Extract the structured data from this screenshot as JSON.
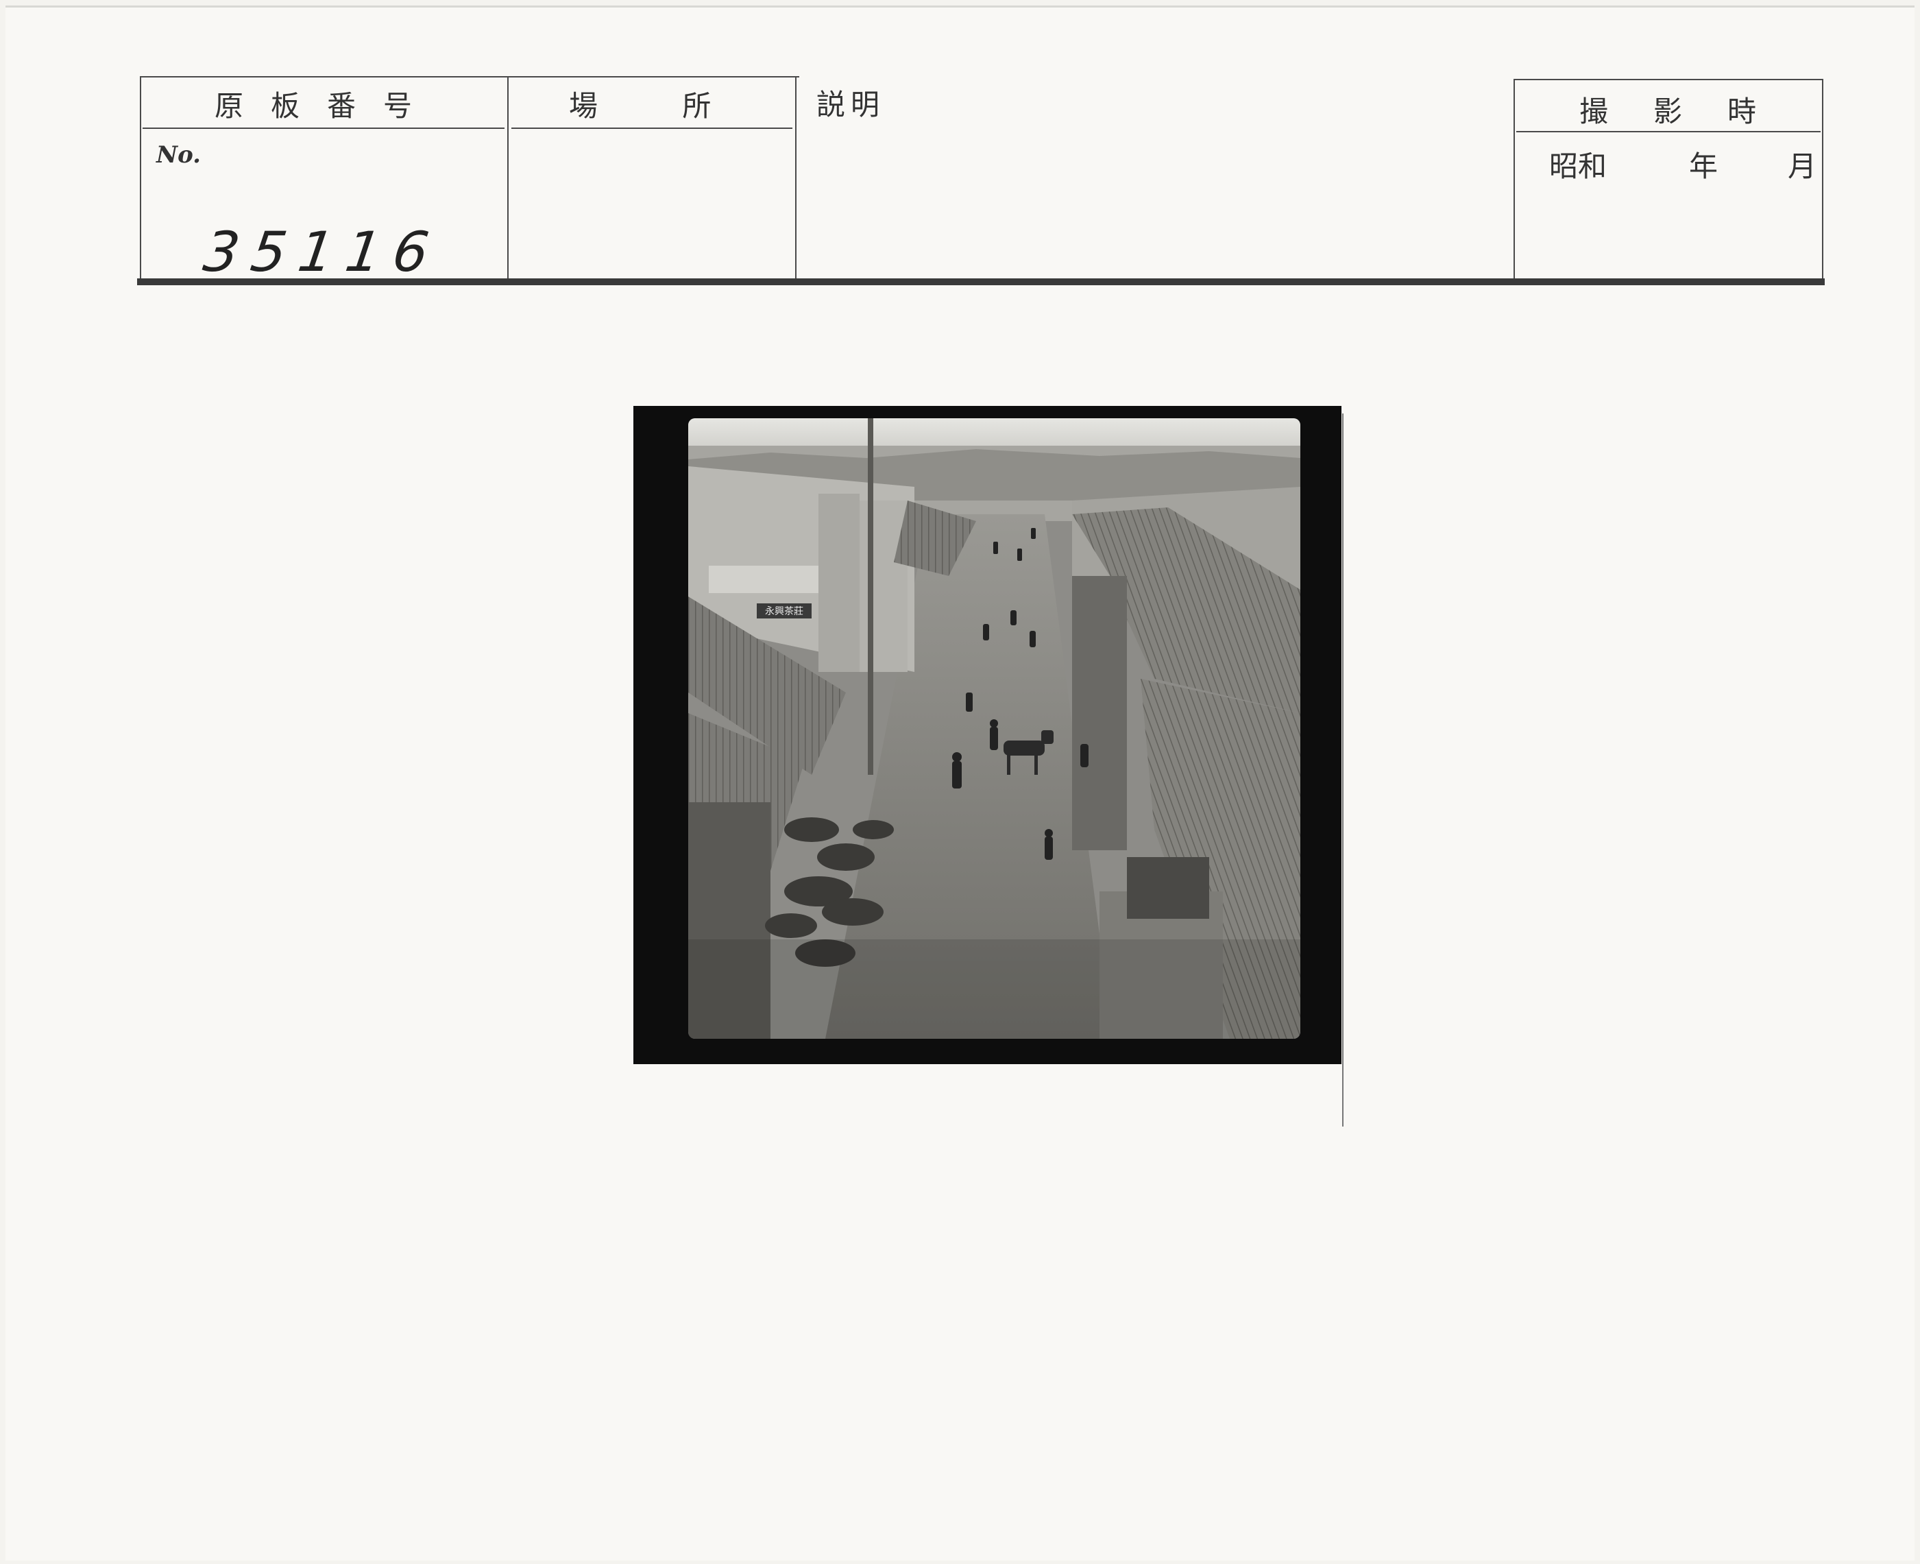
{
  "form": {
    "plate_number_label": "原板番号",
    "number_prefix": "No.",
    "plate_number_value": "35116",
    "location_label": "場 所",
    "description_label": "説明",
    "date_label": "撮影時",
    "era_label": "昭和",
    "year_label": "年",
    "month_label": "月"
  },
  "photo": {
    "shop_sign": "永興茶莊"
  }
}
